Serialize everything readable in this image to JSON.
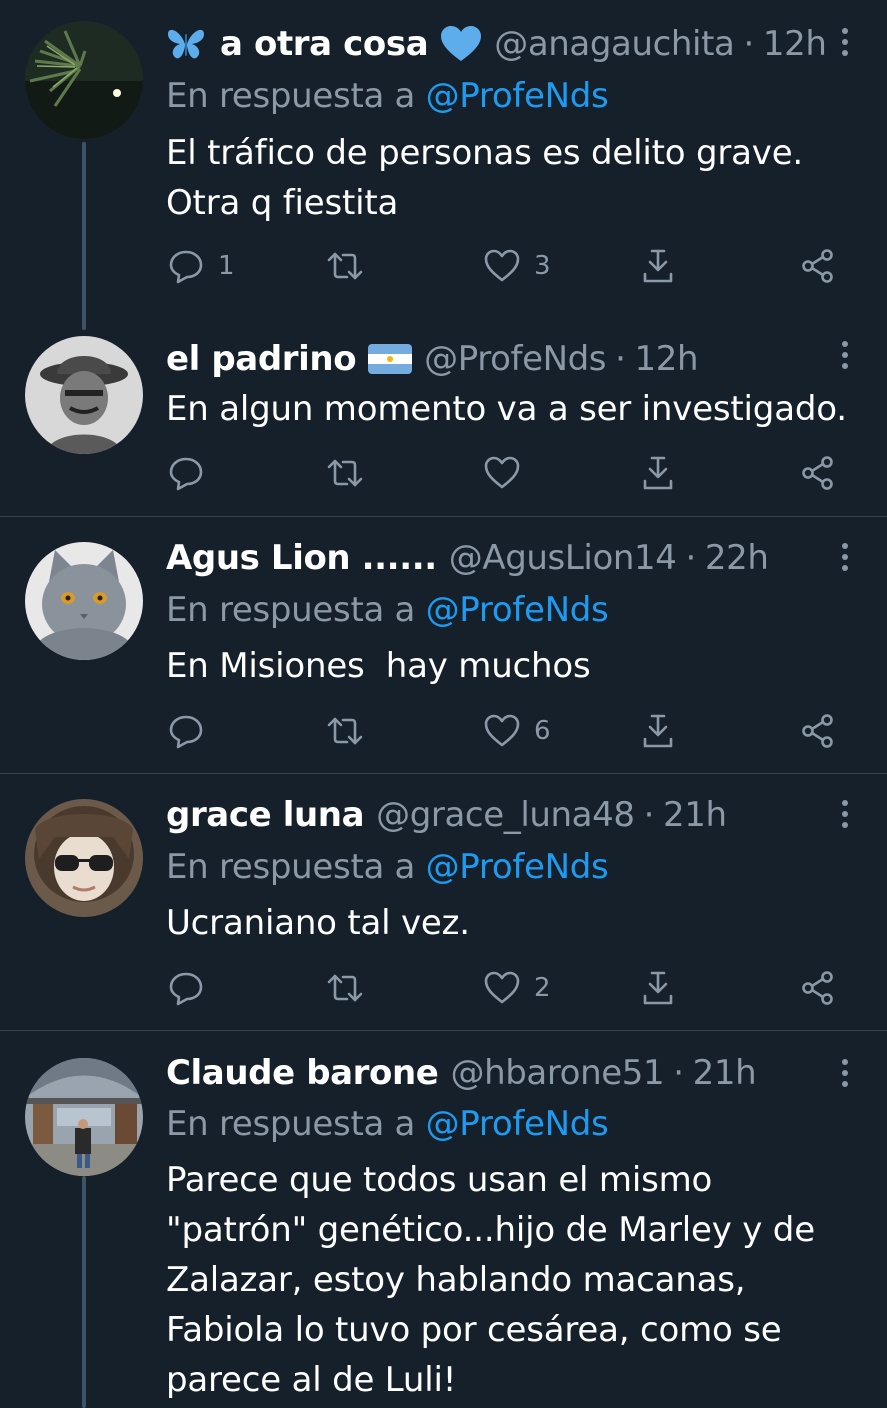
{
  "reply_prefix": "En respuesta a",
  "tweets": [
    {
      "name": "a otra cosa",
      "handle": "@anagauchita",
      "time": "12h",
      "reply_to": "@ProfeNds",
      "text": "El tráfico de personas es delito grave.\nOtra q fiestita",
      "replies": "1",
      "retweets": "",
      "likes": "3",
      "name_icons": [
        "butterfly-emoji-icon",
        "blue-heart-emoji-icon"
      ]
    },
    {
      "name": "el padrino",
      "handle": "@ProfeNds",
      "time": "12h",
      "reply_to": "",
      "text": "En algun momento va a ser investigado.",
      "replies": "",
      "retweets": "",
      "likes": "",
      "name_icons": [
        "argentina-flag-icon"
      ]
    },
    {
      "name": "Agus Lion ......",
      "handle": "@AgusLion14",
      "time": "22h",
      "reply_to": "@ProfeNds",
      "text": "En Misiones  hay muchos",
      "replies": "",
      "retweets": "",
      "likes": "6",
      "name_icons": []
    },
    {
      "name": "grace luna",
      "handle": "@grace_luna48",
      "time": "21h",
      "reply_to": "@ProfeNds",
      "text": "Ucraniano tal vez.",
      "replies": "",
      "retweets": "",
      "likes": "2",
      "name_icons": []
    },
    {
      "name": "Claude barone",
      "handle": "@hbarone51",
      "time": "21h",
      "reply_to": "@ProfeNds",
      "text": "Parece que todos usan el mismo \"patrón\" genético...hijo de Marley y de Zalazar, estoy hablando macanas, Fabiola lo tuvo por cesárea, como se parece al de Luli!",
      "replies": "",
      "retweets": "",
      "likes": "",
      "name_icons": []
    }
  ],
  "colors": {
    "background": "#15202b",
    "text_primary": "#ffffff",
    "text_secondary": "#8b98a5",
    "accent": "#1d9bf0",
    "divider": "#38444d"
  },
  "icons": [
    "reply-icon",
    "retweet-icon",
    "like-icon",
    "download-icon",
    "share-icon",
    "more-icon"
  ]
}
